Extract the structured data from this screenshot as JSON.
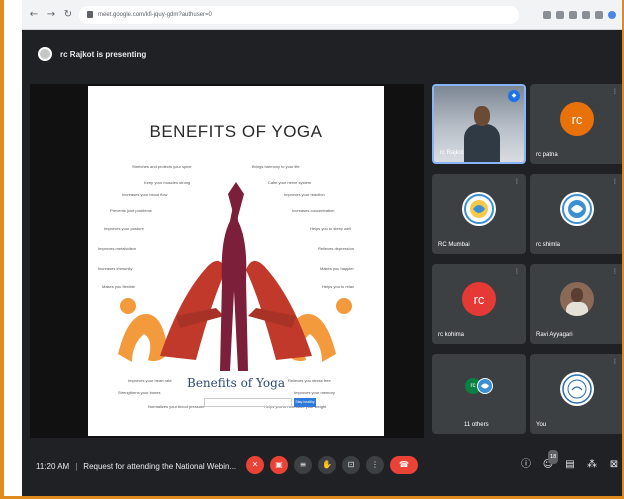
{
  "browser": {
    "url": "meet.google.com/kfi-jquy-gdm?authuser=0",
    "back_icon": "arrow-left",
    "forward_icon": "arrow-right",
    "reload_icon": "reload"
  },
  "presenting": {
    "text": "rc Rajkot is presenting"
  },
  "slide": {
    "title": "BENEFITS OF YOGA",
    "subtitle": "Benefits of Yoga",
    "button_label": "Stay healthy",
    "left_benefits": [
      "Stretches and protects your spine",
      "Keep your muscles strong",
      "Increases your blood flow",
      "Prevents joint problems",
      "Improves your posture",
      "Improves metabolism",
      "Increases immunity",
      "Makes you flexible"
    ],
    "right_benefits": [
      "Brings harmony to your life",
      "Calm your nerve system",
      "Improves your reaction",
      "Increases concentration",
      "Helps you to sleep well",
      "Relieves depression",
      "Makes you happier",
      "Helps you to relax"
    ],
    "bottom_left": [
      "Improves your heart rate",
      "Strengthens your bones",
      "Normalizes your blood pressure"
    ],
    "bottom_right": [
      "Relieves you stress free",
      "Improves your memory",
      "Helps you to normalize your weight"
    ]
  },
  "participants": [
    {
      "name": "rc Rajkot",
      "type": "video"
    },
    {
      "name": "rc patna",
      "type": "avatar",
      "initials": "rc",
      "color": "#e8710a"
    },
    {
      "name": "RC Mumbai",
      "type": "logo"
    },
    {
      "name": "rc shimla",
      "type": "logo"
    },
    {
      "name": "rc kohima",
      "type": "avatar",
      "initials": "rc",
      "color": "#e53935"
    },
    {
      "name": "Ravi Ayyagari",
      "type": "photo"
    },
    {
      "name": "11 others",
      "type": "group"
    },
    {
      "name": "You",
      "type": "logo"
    }
  ],
  "controls": {
    "time": "11:20 AM",
    "meeting_title": "Request for attending the National Webin...",
    "participants_count": "18"
  }
}
